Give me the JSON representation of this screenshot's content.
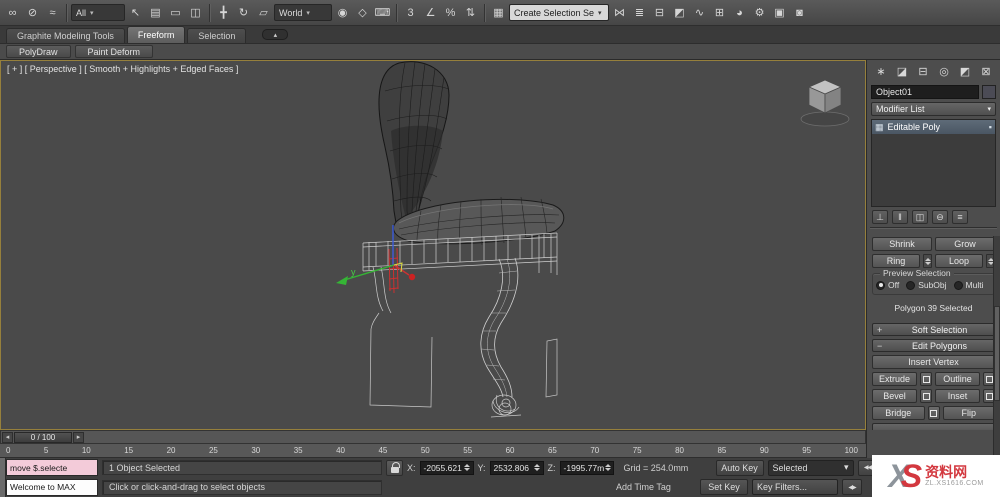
{
  "toolbar": {
    "selection_filter_value": "All",
    "coord_system_value": "World",
    "named_sets_value": "Create Selection Se",
    "groups": {
      "g1": [
        {
          "name": "select-and-link-icon",
          "glyph": "∞"
        },
        {
          "name": "unlink-selection-icon",
          "glyph": "⊘"
        },
        {
          "name": "bind-to-space-warp-icon",
          "glyph": "≈"
        }
      ],
      "g2": [
        {
          "name": "select-object-icon",
          "glyph": "↖"
        },
        {
          "name": "select-by-name-icon",
          "glyph": "▤"
        },
        {
          "name": "rectangular-selection-region-icon",
          "glyph": "▭"
        },
        {
          "name": "window-crossing-icon",
          "glyph": "◫"
        }
      ],
      "g3": [
        {
          "name": "select-and-move-icon",
          "glyph": "╋"
        },
        {
          "name": "select-and-rotate-icon",
          "glyph": "↻"
        },
        {
          "name": "select-and-scale-icon",
          "glyph": "▱"
        }
      ],
      "g4": [
        {
          "name": "use-pivot-point-center-icon",
          "glyph": "◉"
        },
        {
          "name": "select-and-manipulate-icon",
          "glyph": "◇"
        },
        {
          "name": "keyboard-shortcut-override-icon",
          "glyph": "⌨"
        }
      ],
      "g5": [
        {
          "name": "snaps-toggle-3-icon",
          "glyph": "3"
        },
        {
          "name": "angle-snap-icon",
          "glyph": "∠"
        },
        {
          "name": "percent-snap-icon",
          "glyph": "%"
        },
        {
          "name": "spinner-snap-icon",
          "glyph": "⇅"
        }
      ],
      "g6": [
        {
          "name": "edit-named-selection-sets-icon",
          "glyph": "▦"
        }
      ],
      "g7": [
        {
          "name": "mirror-icon",
          "glyph": "⋈"
        },
        {
          "name": "align-icon",
          "glyph": "≣"
        },
        {
          "name": "layer-manager-icon",
          "glyph": "⊟"
        },
        {
          "name": "graphite-toggle-icon",
          "glyph": "◩"
        },
        {
          "name": "curve-editor-icon",
          "glyph": "∿"
        },
        {
          "name": "schematic-view-icon",
          "glyph": "⊞"
        },
        {
          "name": "material-editor-icon",
          "glyph": "◕"
        },
        {
          "name": "render-setup-icon",
          "glyph": "⚙"
        },
        {
          "name": "rendered-frame-window-icon",
          "glyph": "▣"
        },
        {
          "name": "render-production-icon",
          "glyph": "◙"
        }
      ]
    }
  },
  "icons": {
    "dropdown_arrow": "▾",
    "ribbon_collapse": "▴",
    "slider_left": "◂",
    "slider_right": "▸",
    "transport_r1": "◀◀",
    "transport_r2": "◀▶",
    "plus": "+",
    "minus": "−",
    "stack_item_icon": "▦",
    "stack_item_end_icon": "▪"
  },
  "ribbon": {
    "tab_graphite": "Graphite Modeling Tools",
    "tab_freeform": "Freeform",
    "tab_selection": "Selection",
    "sub_polydraw": "PolyDraw",
    "sub_paintdeform": "Paint Deform"
  },
  "viewport": {
    "label": "[ + ] [ Perspective ] [ Smooth + Highlights + Edged Faces ]",
    "gizmo_y_label": "y"
  },
  "timeline": {
    "slider_label": "0 / 100",
    "ticks": [
      "0",
      "5",
      "10",
      "15",
      "20",
      "25",
      "30",
      "35",
      "40",
      "45",
      "50",
      "55",
      "60",
      "65",
      "70",
      "75",
      "80",
      "85",
      "90",
      "95",
      "100"
    ]
  },
  "panel": {
    "tabs": [
      {
        "name": "create-tab-icon",
        "glyph": "∗"
      },
      {
        "name": "modify-tab-icon",
        "glyph": "◪"
      },
      {
        "name": "hierarchy-tab-icon",
        "glyph": "⊟"
      },
      {
        "name": "motion-tab-icon",
        "glyph": "◎"
      },
      {
        "name": "display-tab-icon",
        "glyph": "◩"
      },
      {
        "name": "utilities-tab-icon",
        "glyph": "⊠"
      }
    ],
    "object_name": "Object01",
    "object_color": "#4b4b55",
    "modifier_list_label": "Modifier List",
    "stack_item": "Editable Poly",
    "stack_tools": [
      {
        "name": "pin-stack-icon",
        "glyph": "⊥"
      },
      {
        "name": "show-end-result-icon",
        "glyph": "‖"
      },
      {
        "name": "make-unique-icon",
        "glyph": "◫"
      },
      {
        "name": "remove-modifier-icon",
        "glyph": "⊖"
      },
      {
        "name": "configure-modifier-sets-icon",
        "glyph": "≡"
      }
    ],
    "shrink": "Shrink",
    "grow": "Grow",
    "ring": "Ring",
    "loop": "Loop",
    "preview_selection_label": "Preview Selection",
    "preview_off": "Off",
    "preview_subobj": "SubObj",
    "preview_multi": "Multi",
    "selection_status": "Polygon 39 Selected",
    "soft_selection_header": "Soft Selection",
    "edit_polygons_header": "Edit Polygons",
    "insert_vertex": "Insert Vertex",
    "extrude": "Extrude",
    "outline": "Outline",
    "bevel": "Bevel",
    "inset": "Inset",
    "bridge": "Bridge",
    "flip": "Flip"
  },
  "status": {
    "listener_line1": "move $.selecte",
    "listener_line2": "Welcome to MAX",
    "selected_status": "1 Object Selected",
    "prompt": "Click or click-and-drag to select objects",
    "x_label": "X:",
    "x_value": "-2055.621",
    "y_label": "Y:",
    "y_value": "2532.806",
    "z_label": "Z:",
    "z_value": "-1995.77m",
    "grid_label": "Grid = 254.0mm",
    "add_time_tag": "Add Time Tag",
    "auto_key": "Auto Key",
    "set_key": "Set Key",
    "selected_dropdown": "Selected",
    "key_filters": "Key Filters..."
  },
  "watermark": {
    "x": "X",
    "s": "S",
    "cn": "资料网",
    "url": "ZL.XS1616.COM",
    "red": "#d3383f"
  }
}
